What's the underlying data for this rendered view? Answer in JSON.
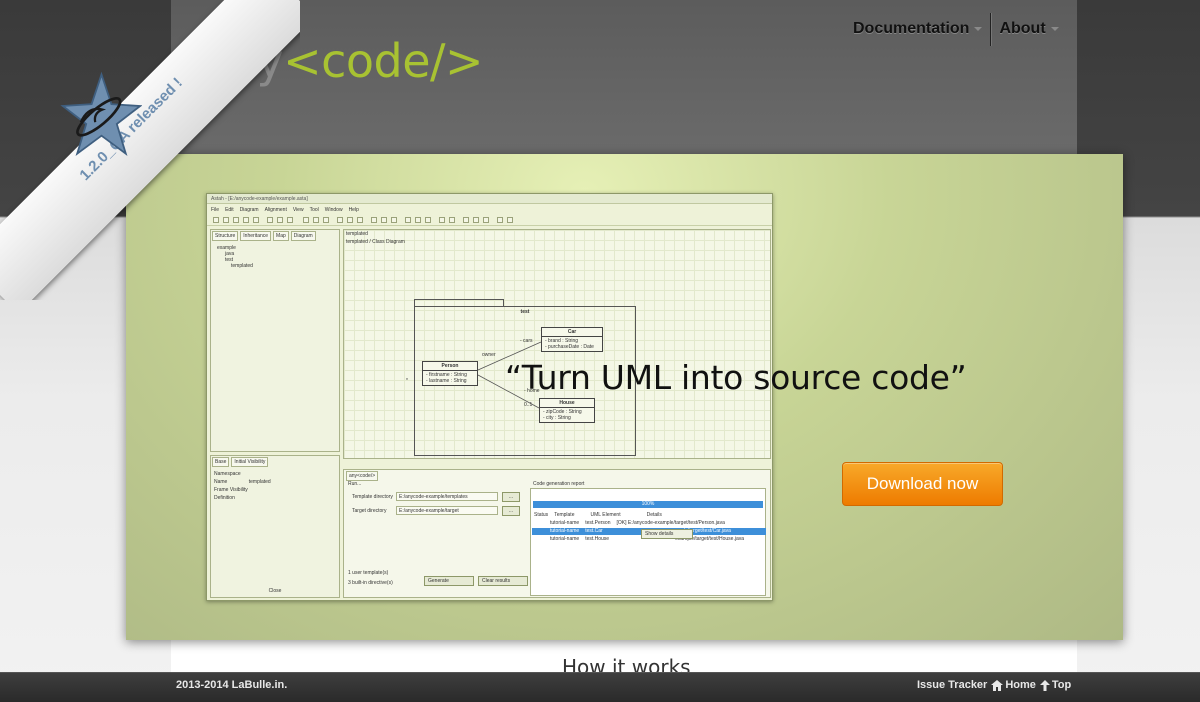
{
  "brand": {
    "logo_any": "any",
    "logo_code": "<code/>"
  },
  "nav": {
    "items": [
      {
        "label": "Documentation"
      },
      {
        "label": "About"
      }
    ]
  },
  "ribbon": {
    "text": "1.2.0_GA released !",
    "badge_icon": "groovy-star-icon"
  },
  "hero": {
    "tagline": "“Turn UML into source code”",
    "download_label": "Download now"
  },
  "app_screenshot": {
    "window_title": "Astah - [E:/anycode-example/example.asta]",
    "menu": [
      "File",
      "Edit",
      "Diagram",
      "Alignment",
      "View",
      "Tool",
      "Window",
      "Help"
    ],
    "left_tabs": [
      "Structure",
      "Inheritance",
      "Map",
      "Diagram"
    ],
    "tree": [
      "example",
      "java",
      "test",
      "templated"
    ],
    "diagram_tab": "templated",
    "diagram_title": "templated / Class Diagram",
    "package_name": "test",
    "classes": [
      {
        "name": "Car",
        "attrs": [
          "- brand : String",
          "- purchaseDate : Date"
        ]
      },
      {
        "name": "Person",
        "attrs": [
          "- firstname : String",
          "- lastname : String"
        ]
      },
      {
        "name": "House",
        "attrs": [
          "- zipCode : String",
          "- city : String"
        ]
      }
    ],
    "assoc_labels": [
      "- cars",
      "owner",
      "- home",
      "0..1",
      "*"
    ],
    "props_tabs": [
      "Base",
      "Initial Visibility"
    ],
    "props_rows": [
      [
        "Namespace",
        ""
      ],
      [
        "Name",
        "templated"
      ],
      [
        "",
        "Frame Visibility"
      ],
      [
        "Definition",
        ""
      ]
    ],
    "props_button": "Close",
    "bottom_tab": "any<code/>",
    "run_label": "Run...",
    "template_dir_label": "Template directory",
    "template_dir_value": "E:/anycode-example/templates",
    "target_dir_label": "Target directory",
    "target_dir_value": "E:/anycode-example/target",
    "browse_label": "...",
    "user_templates": "1 user template(s)",
    "builtin_directives": "3 built-in directive(s)",
    "generate_label": "Generate",
    "clear_label": "Clear results",
    "report_title": "Code generation report",
    "progress_text": "100%",
    "report_headers": [
      "Status",
      "Template",
      "UML Element",
      "Details"
    ],
    "report_rows": [
      [
        "tutorial-name",
        "test.Person",
        "[OK] E:/anycode-example/target/test/Person.java"
      ],
      [
        "tutorial-name",
        "test.Car",
        "example/target/test/Car.java"
      ],
      [
        "tutorial-name",
        "test.House",
        "example/target/test/House.java"
      ]
    ],
    "show_details_label": "Show details"
  },
  "section": {
    "how_title": "How it works"
  },
  "footer": {
    "copyright": "2013-2014 LaBulle.in.",
    "links": [
      {
        "label": "Issue Tracker"
      },
      {
        "label": "Home",
        "icon": "home-icon"
      },
      {
        "label": "Top",
        "icon": "arrow-up-icon"
      }
    ]
  },
  "colors": {
    "accent_green": "#a8c232",
    "download_orange": "#f39a1a",
    "ribbon_text": "#6f8fb0"
  }
}
